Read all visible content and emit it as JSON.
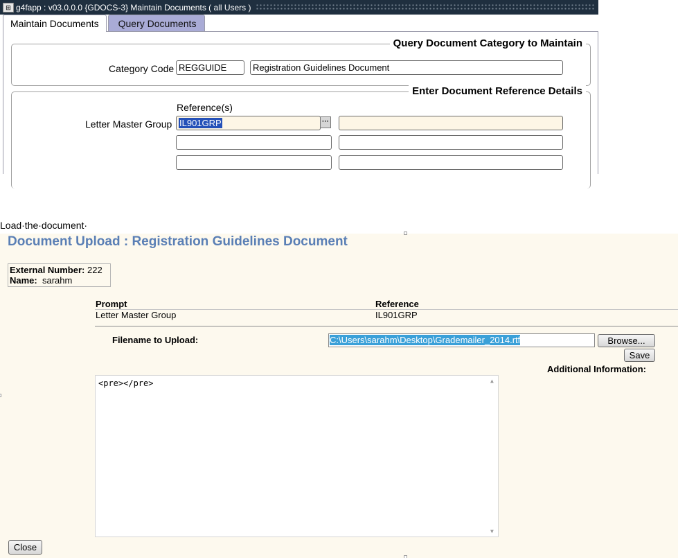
{
  "app_window": {
    "title": "g4fapp : v03.0.0.0  {GDOCS-3} Maintain Documents ( all Users )",
    "tabs": [
      {
        "label": "Maintain Documents",
        "active": true
      },
      {
        "label": "Query Documents",
        "active": false
      }
    ],
    "query_group": {
      "title": "Query Document Category to Maintain",
      "category_code_label": "Category Code",
      "category_code_value": "REGGUIDE",
      "category_description": "Registration Guidelines Document"
    },
    "reference_group": {
      "title": "Enter Document Reference Details",
      "references_header": "Reference(s)",
      "row_label": "Letter Master Group",
      "reference_value": "IL901GRP",
      "lookup_button": "···"
    }
  },
  "caption": "Load·the·document·",
  "upload": {
    "title": "Document Upload : Registration Guidelines Document",
    "external_number_label": "External Number:",
    "external_number_value": "222",
    "name_label": "Name:",
    "name_value": "sarahm",
    "prompt_header": "Prompt",
    "reference_header": "Reference",
    "prompt_value": "Letter Master Group",
    "reference_value": "IL901GRP",
    "filename_label": "Filename to Upload:",
    "filename_value": "C:\\Users\\sarahm\\Desktop\\Grademailer_2014.rtf",
    "browse_label": "Browse...",
    "save_label": "Save",
    "additional_info_label": "Additional Information:",
    "textarea_value": "<pre></pre>",
    "close_label": "Close"
  },
  "colors": {
    "titlebar_bg": "#1f2f3f",
    "inactive_tab_bg": "#a9abd6",
    "selection_dark": "#2450b8",
    "selection_light": "#3aa0d8",
    "upload_bg": "#fdf9ee",
    "upload_title": "#5a7fb5"
  }
}
